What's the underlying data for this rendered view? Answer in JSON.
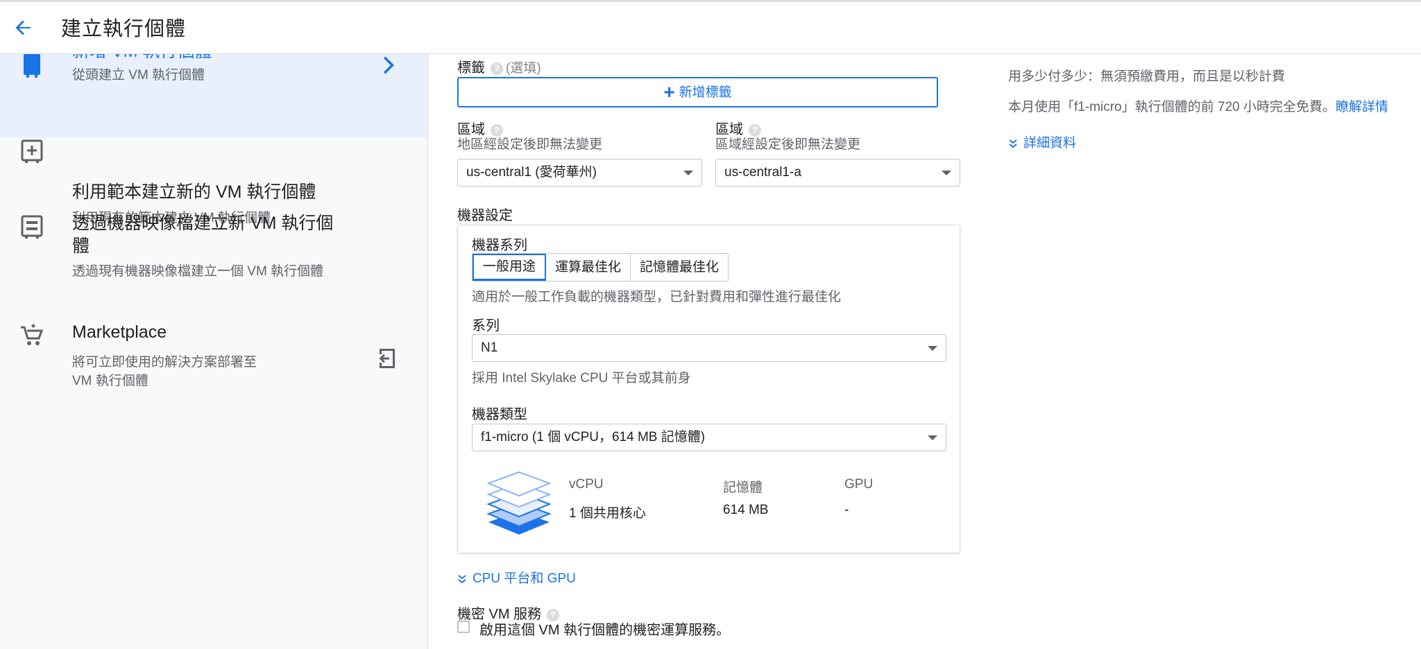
{
  "header": {
    "title": "建立執行個體"
  },
  "sidebar": {
    "items": [
      {
        "title": "新增 VM 執行個體",
        "subtitle": "從頭建立 VM 執行個體"
      },
      {
        "title": "利用範本建立新的 VM 執行個體",
        "subtitle": "利用現有的範本建立 VM 執行個體"
      },
      {
        "title": "透過機器映像檔建立新 VM 執行個體",
        "subtitle": "透過現有機器映像檔建立一個 VM 執行個體"
      },
      {
        "title": "Marketplace",
        "subtitle": "將可立即使用的解決方案部署至 VM 執行個體"
      }
    ]
  },
  "labels": {
    "title": "標籤",
    "optional": "(選填)",
    "add_button": "新增標籤"
  },
  "region": {
    "label": "區域",
    "hint": "地區經設定後即無法變更",
    "value": "us-central1 (愛荷華州)"
  },
  "zone": {
    "label": "區域",
    "hint": "區域經設定後即無法變更",
    "value": "us-central1-a"
  },
  "machine_config": {
    "title": "機器設定",
    "family_label": "機器系列",
    "tabs": [
      "一般用途",
      "運算最佳化",
      "記憶體最佳化"
    ],
    "family_desc": "適用於一般工作負載的機器類型，已針對費用和彈性進行最佳化",
    "series_label": "系列",
    "series_value": "N1",
    "series_desc": "採用 Intel Skylake CPU 平台或其前身",
    "type_label": "機器類型",
    "type_value": "f1-micro (1 個 vCPU，614 MB 記憶體)",
    "spec_headers": {
      "vcpu": "vCPU",
      "memory": "記憶體",
      "gpu": "GPU"
    },
    "spec_values": {
      "vcpu": "1 個共用核心",
      "memory": "614 MB",
      "gpu": "-"
    }
  },
  "cpu_gpu_expander": "CPU 平台和 GPU",
  "confidential": {
    "title": "機密 VM 服務",
    "checkbox_label": "啟用這個 VM 執行個體的機密運算服務。"
  },
  "pricing": {
    "line1": "用多少付多少：無須預繳費用，而且是以秒計費",
    "line2": "本月使用「f1-micro」執行個體的前 720 小時完全免費。",
    "learn_more": "瞭解詳情",
    "details": "詳細資料"
  },
  "colors": {
    "accent": "#1a73e8",
    "selected_bg": "#e8f0fe",
    "sidebar_bg": "#f8f9fa"
  }
}
